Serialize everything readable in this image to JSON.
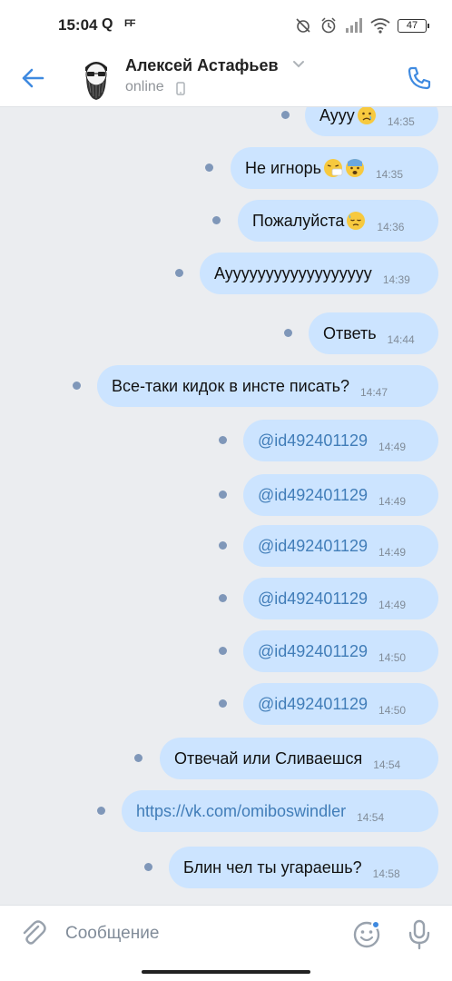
{
  "status_bar": {
    "time": "15:04",
    "q_icon": "Q",
    "ff_icon": "FF",
    "battery": "47",
    "icons": [
      "alarm-off-icon",
      "alarm-icon",
      "signal-icon",
      "wifi-icon",
      "battery-icon"
    ]
  },
  "header": {
    "name": "Алексей Астафьев",
    "status": "online",
    "back_icon": "arrow-left-icon",
    "call_icon": "phone-icon",
    "device_icon": "mobile-icon"
  },
  "messages": [
    {
      "text": "Аууу",
      "emoji": [
        "crying-face"
      ],
      "time": "14:35",
      "link": false
    },
    {
      "text": "Не игнорь",
      "emoji": [
        "sneezing-face",
        "fearful-face"
      ],
      "time": "14:35",
      "link": false
    },
    {
      "text": "Пожалуйста",
      "emoji": [
        "downcast-sweat-face"
      ],
      "time": "14:36",
      "link": false
    },
    {
      "text": "Ауууууууууууууууууу",
      "emoji": [],
      "time": "14:39",
      "link": false
    },
    {
      "text": "Ответь",
      "emoji": [],
      "time": "14:44",
      "link": false
    },
    {
      "text": "Все-таки кидок в инсте писать?",
      "emoji": [],
      "time": "14:47",
      "link": false
    },
    {
      "text": "@id492401129",
      "emoji": [],
      "time": "14:49",
      "link": true
    },
    {
      "text": "@id492401129",
      "emoji": [],
      "time": "14:49",
      "link": true
    },
    {
      "text": "@id492401129",
      "emoji": [],
      "time": "14:49",
      "link": true
    },
    {
      "text": "@id492401129",
      "emoji": [],
      "time": "14:49",
      "link": true
    },
    {
      "text": "@id492401129",
      "emoji": [],
      "time": "14:50",
      "link": true
    },
    {
      "text": "@id492401129",
      "emoji": [],
      "time": "14:50",
      "link": true
    },
    {
      "text": "Отвечай или Сливаешся",
      "emoji": [],
      "time": "14:54",
      "link": false
    },
    {
      "text": "https://vk.com/omiboswindler",
      "emoji": [],
      "time": "14:54",
      "link": true
    },
    {
      "text": "Блин чел ты угараешь?",
      "emoji": [],
      "time": "14:58",
      "link": false
    }
  ],
  "input": {
    "placeholder": "Сообщение",
    "attach_icon": "paperclip-icon",
    "sticker_icon": "smile-icon",
    "mic_icon": "microphone-icon"
  },
  "colors": {
    "accent": "#3f8ae0",
    "bubble": "#cce4ff",
    "background": "#ebedf0",
    "unread_dot": "#7f97b9",
    "link": "#3a78b5"
  }
}
